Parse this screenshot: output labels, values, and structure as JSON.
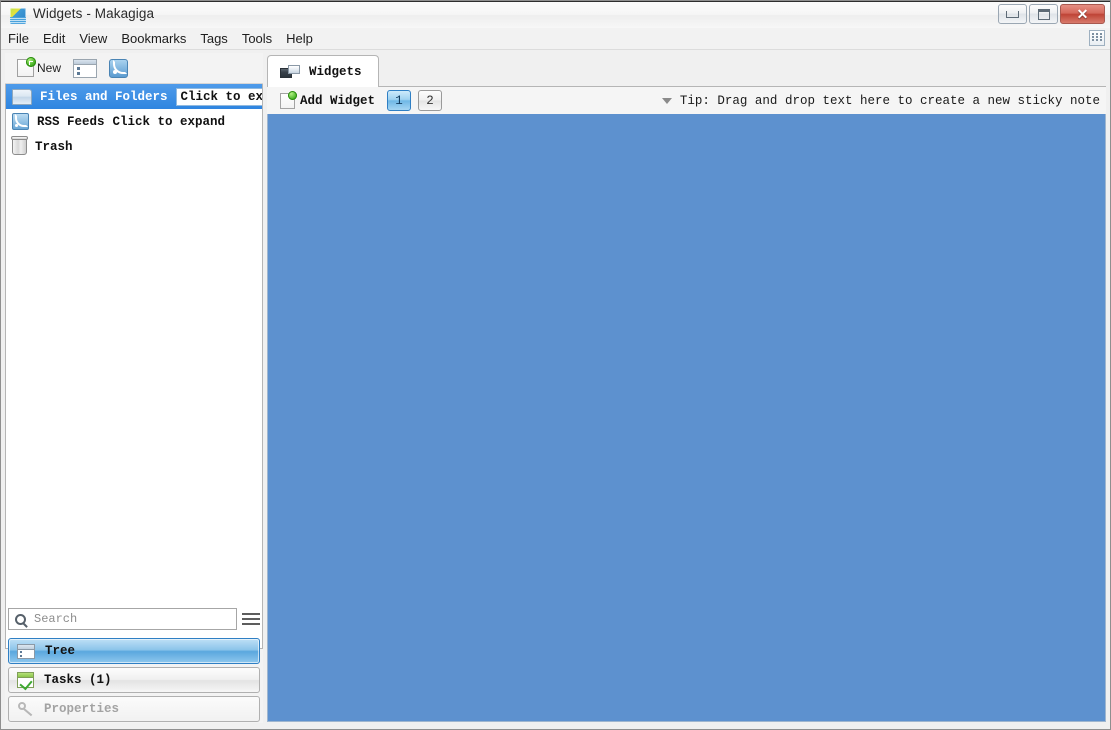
{
  "window": {
    "title": "Widgets - Makagiga",
    "app_icon": "makagiga-icon",
    "controls": {
      "minimize": "minimize",
      "maximize": "maximize",
      "close": "close"
    }
  },
  "menubar": {
    "items": [
      {
        "label": "File"
      },
      {
        "label": "Edit"
      },
      {
        "label": "View"
      },
      {
        "label": "Bookmarks"
      },
      {
        "label": "Tags"
      },
      {
        "label": "Tools"
      },
      {
        "label": "Help"
      }
    ],
    "right_icon": "grid-icon"
  },
  "sidebar": {
    "toolbar": {
      "new_label": "New",
      "new_icon": "new-document-icon",
      "tree_icon": "tree-view-icon",
      "rss_icon": "rss-feed-icon"
    },
    "tree_items": [
      {
        "label": "Files and Folders",
        "hint": "Click to expand",
        "icon": "folder-icon",
        "selected": true
      },
      {
        "label": "RSS Feeds",
        "hint": "Click to expand",
        "icon": "rss-icon",
        "selected": false
      },
      {
        "label": "Trash",
        "hint": "",
        "icon": "trash-icon",
        "selected": false
      }
    ],
    "search": {
      "placeholder": "Search",
      "value": "",
      "icon": "search-icon",
      "menu_icon": "hamburger-menu-icon"
    },
    "panel_buttons": [
      {
        "label": "Tree",
        "icon": "tree-icon",
        "state": "active"
      },
      {
        "label": "Tasks (1)",
        "icon": "tasks-icon",
        "state": "normal"
      },
      {
        "label": "Properties",
        "icon": "properties-icon",
        "state": "disabled"
      }
    ]
  },
  "main": {
    "tabs": [
      {
        "label": "Widgets",
        "icon": "widgets-icon",
        "selected": true
      }
    ],
    "toolbar": {
      "add_widget_label": "Add Widget",
      "add_widget_icon": "add-widget-icon",
      "pages": [
        {
          "label": "1",
          "active": true
        },
        {
          "label": "2",
          "active": false
        }
      ],
      "tip_text": "Tip: Drag and drop text here to create a new sticky note",
      "tip_arrow_icon": "triangle-down-icon"
    },
    "canvas": {
      "background_color": "#5d91cf"
    }
  },
  "colors": {
    "canvas_blue": "#5d91cf",
    "selection_blue": "#2f85e0",
    "titlebar": "#f6f6f6",
    "close_red": "#bf4436"
  }
}
